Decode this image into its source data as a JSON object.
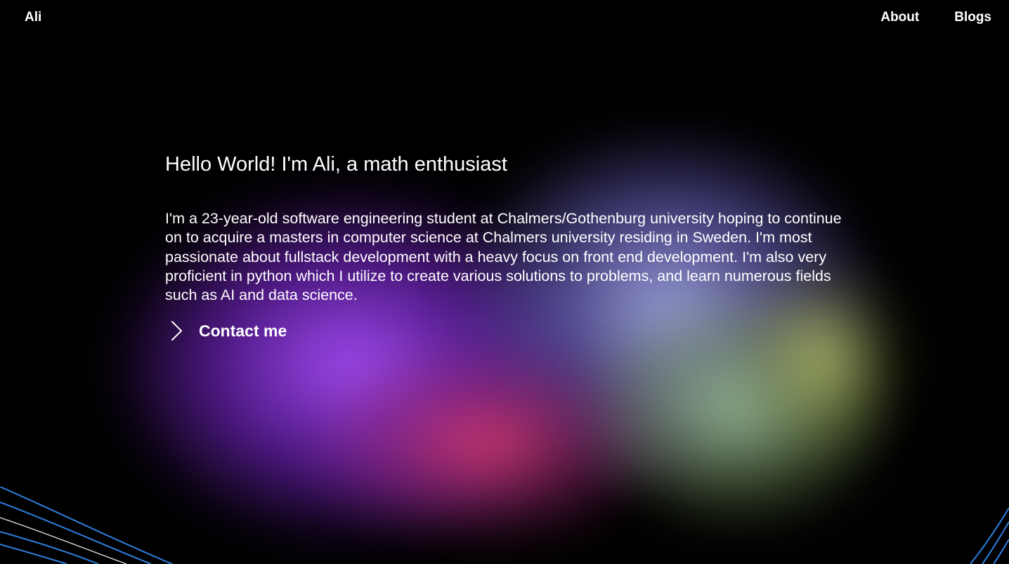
{
  "header": {
    "logo_text": "Ali",
    "nav": [
      {
        "label": "About"
      },
      {
        "label": "Blogs"
      }
    ]
  },
  "hero": {
    "title": "Hello World! I'm Ali, a math enthusiast",
    "bio": "I'm a 23-year-old software engineering student at Chalmers/Gothenburg university hoping to continue on to acquire a masters in computer science at Chalmers university residing in Sweden. I'm most passionate about fullstack development with a heavy focus on front end development. I'm also very proficient in python which I utilize to create various solutions to problems, and learn numerous fields such as AI and data science.",
    "cta": {
      "label": "Contact me",
      "icon": "chevron-right-icon"
    }
  },
  "theme": {
    "background": "#000000",
    "text": "#ffffff",
    "accent_lines": "#2f7fe0"
  }
}
